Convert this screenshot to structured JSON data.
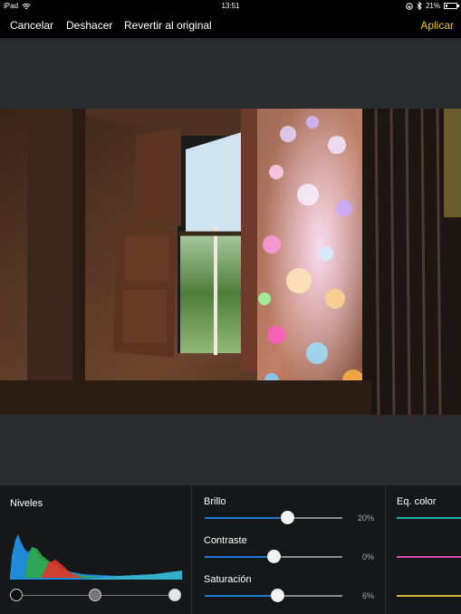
{
  "status": {
    "device": "iPad",
    "time": "13:51",
    "battery": "21%",
    "battery_level": 0.21
  },
  "toolbar": {
    "cancel_label": "Cancelar",
    "undo_label": "Deshacer",
    "revert_label": "Revertir al original",
    "apply_label": "Aplicar"
  },
  "colors": {
    "accent": "#f5c400",
    "slider_fill": "#1e7ad8",
    "canvas_bg": "#2a2c2f",
    "panel_bg": "#161718"
  },
  "levels": {
    "title": "Niveles",
    "knobs": {
      "black": 0.0,
      "mid": 0.5,
      "white": 1.0
    }
  },
  "adjustments": [
    {
      "label": "Brillo",
      "value_text": "20%",
      "value": 0.6
    },
    {
      "label": "Contraste",
      "value_text": "0%",
      "value": 0.5
    },
    {
      "label": "Saturación",
      "value_text": "6%",
      "value": 0.53
    }
  ],
  "color_eq": {
    "title": "Eq. color",
    "lines": [
      "#1fb5a5",
      "#d94aa6",
      "#d9b43a"
    ]
  }
}
